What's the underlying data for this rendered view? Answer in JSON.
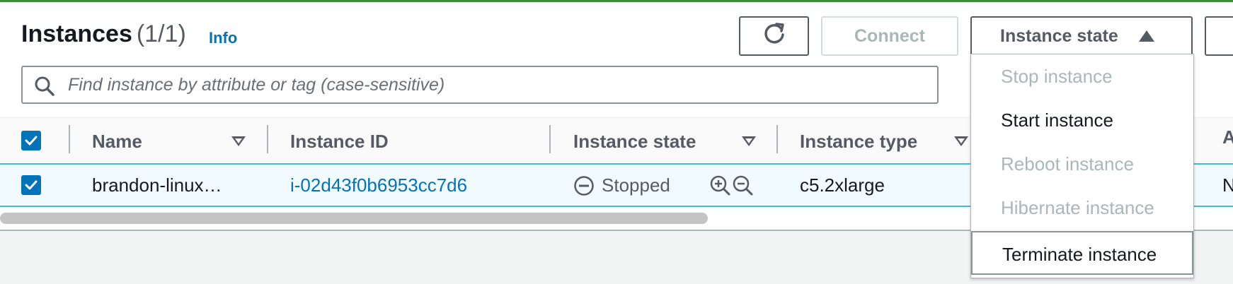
{
  "header": {
    "title": "Instances",
    "count": "(1/1)",
    "info_link": "Info"
  },
  "toolbar": {
    "refresh_icon": "refresh-icon",
    "connect_label": "Connect",
    "instance_state_label": "Instance state"
  },
  "search": {
    "placeholder": "Find instance by attribute or tag (case-sensitive)"
  },
  "table": {
    "columns": [
      "Name",
      "Instance ID",
      "Instance state",
      "Instance type"
    ],
    "rows": [
      {
        "name": "brandon-linux…",
        "instance_id": "i-02d43f0b6953cc7d6",
        "state": "Stopped",
        "type": "c5.2xlarge"
      }
    ],
    "cut_col_header": "A",
    "cut_col_value": "N"
  },
  "dropdown": {
    "items": [
      {
        "label": "Stop instance",
        "enabled": false
      },
      {
        "label": "Start instance",
        "enabled": true
      },
      {
        "label": "Reboot instance",
        "enabled": false
      },
      {
        "label": "Hibernate instance",
        "enabled": false
      },
      {
        "label": "Terminate instance",
        "enabled": true
      }
    ]
  },
  "colors": {
    "link": "#0073bb",
    "selected_row": "#f1faff",
    "selected_border": "#44b9d6",
    "disabled_text": "#aab7b8"
  }
}
